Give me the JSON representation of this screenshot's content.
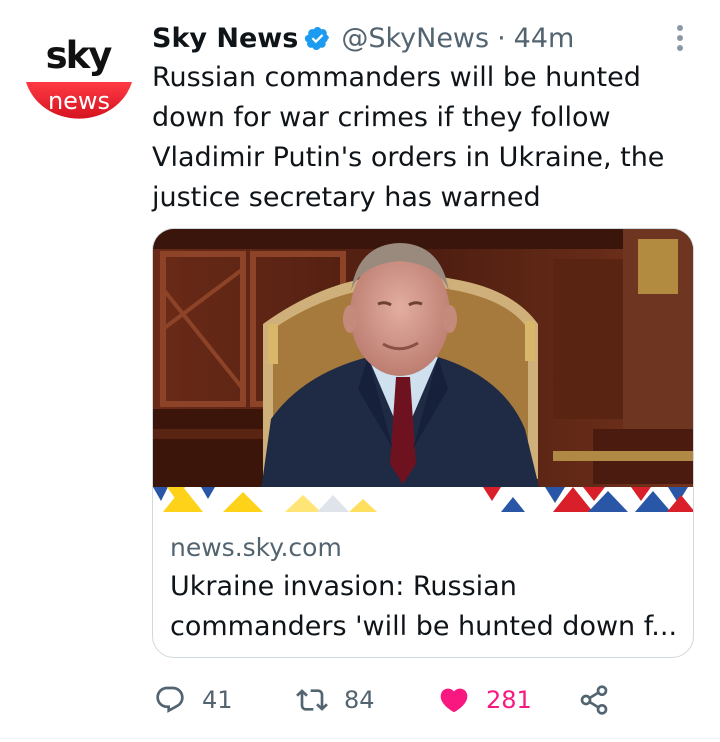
{
  "tweet": {
    "avatar": {
      "brand_top": "sky",
      "brand_bottom": "news"
    },
    "author_name": "Sky News",
    "handle": "@SkyNews",
    "separator": "·",
    "time": "44m",
    "text": "Russian commanders will be hunted down for war crimes if they follow Vladimir Putin's orders in Ukraine, the justice secretary has warned",
    "card": {
      "domain": "news.sky.com",
      "title": "Ukraine invasion: Russian commanders 'will be hunted down f..."
    },
    "actions": {
      "replies": "41",
      "retweets": "84",
      "likes": "281"
    }
  },
  "colors": {
    "text": "#0f1419",
    "secondary": "#536471",
    "verified": "#1d9bf0",
    "like": "#f91880",
    "sky_red": "#e8202c"
  },
  "icons": [
    "more-vertical-icon",
    "verified-badge-icon",
    "reply-icon",
    "retweet-icon",
    "heart-icon",
    "share-icon"
  ]
}
